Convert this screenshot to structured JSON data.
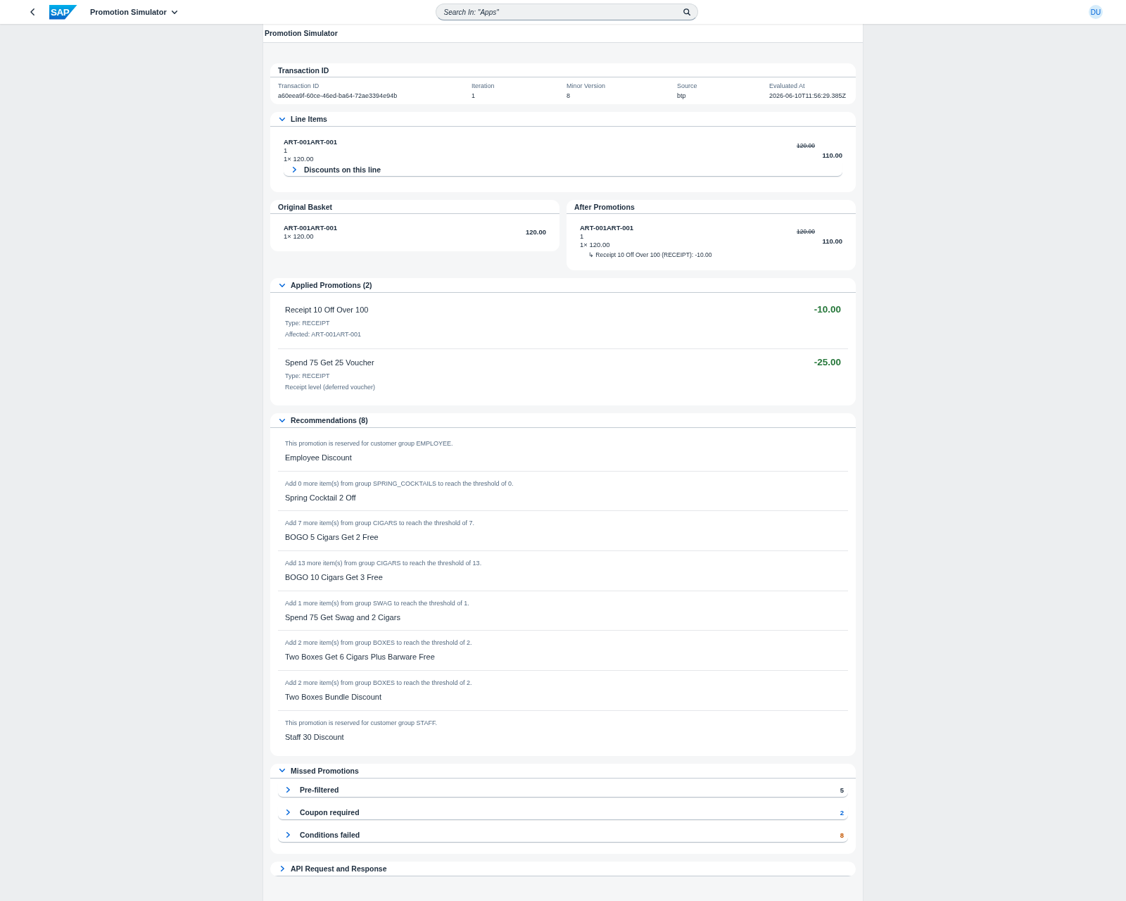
{
  "shell": {
    "logo": "SAP",
    "title": "Promotion Simulator",
    "search": {
      "placeholder": "Search In: \"Apps\""
    },
    "avatar": "DU"
  },
  "page_header": {
    "title": "Promotion Simulator"
  },
  "transaction": {
    "title": "Transaction ID",
    "fields": [
      {
        "label": "Transaction ID",
        "value": "a60eea9f-60ce-46ed-ba64-72ae3394e94b"
      },
      {
        "label": "Iteration",
        "value": "1"
      },
      {
        "label": "Minor Version",
        "value": "8"
      },
      {
        "label": "Source",
        "value": "btp"
      },
      {
        "label": "Evaluated At",
        "value": "2026-06-10T11:56:29.385Z"
      }
    ]
  },
  "line_items": {
    "title": "Line Items",
    "expanded": true,
    "items": [
      {
        "name": "ART-001ART-001",
        "quantity": "1",
        "unit_price": "1× 120.00",
        "original_price": "120.00",
        "price": "110.00",
        "discounts": {
          "title": "Discounts on this line",
          "expanded": false
        }
      }
    ]
  },
  "original_basket": {
    "title": "Original Basket",
    "items": [
      {
        "name": "ART-001ART-001",
        "unit_price": "1× 120.00",
        "price": "120.00"
      }
    ]
  },
  "after_promotions": {
    "title": "After Promotions",
    "items": [
      {
        "name": "ART-001ART-001",
        "quantity": "1",
        "unit_price": "1× 120.00",
        "original_price": "120.00",
        "price": "110.00",
        "notes": [
          "↳ Receipt 10 Off Over 100 (RECEIPT): -10.00"
        ]
      }
    ]
  },
  "applied_promotions": {
    "title": "Applied Promotions (2)",
    "expanded": true,
    "items": [
      {
        "name": "Receipt 10 Off Over 100",
        "amount": "-10.00",
        "details": [
          "Type: RECEIPT",
          "Affected: ART-001ART-001"
        ]
      },
      {
        "name": "Spend 75 Get 25 Voucher",
        "amount": "-25.00",
        "details": [
          "Type: RECEIPT",
          "Receipt level (deferred voucher)"
        ]
      }
    ]
  },
  "recommendations": {
    "title": "Recommendations (8)",
    "expanded": true,
    "items": [
      {
        "hint": "This promotion is reserved for customer group EMPLOYEE.",
        "name": "Employee Discount"
      },
      {
        "hint": "Add 0 more item(s) from group SPRING_COCKTAILS to reach the threshold of 0.",
        "name": "Spring Cocktail 2 Off"
      },
      {
        "hint": "Add 7 more item(s) from group CIGARS to reach the threshold of 7.",
        "name": "BOGO 5 Cigars Get 2 Free"
      },
      {
        "hint": "Add 13 more item(s) from group CIGARS to reach the threshold of 13.",
        "name": "BOGO 10 Cigars Get 3 Free"
      },
      {
        "hint": "Add 1 more item(s) from group SWAG to reach the threshold of 1.",
        "name": "Spend 75 Get Swag and 2 Cigars"
      },
      {
        "hint": "Add 2 more item(s) from group BOXES to reach the threshold of 2.",
        "name": "Two Boxes Get 6 Cigars Plus Barware Free"
      },
      {
        "hint": "Add 2 more item(s) from group BOXES to reach the threshold of 2.",
        "name": "Two Boxes Bundle Discount"
      },
      {
        "hint": "This promotion is reserved for customer group STAFF.",
        "name": "Staff 30 Discount"
      }
    ]
  },
  "missed_promotions": {
    "title": "Missed Promotions",
    "expanded": true,
    "groups": [
      {
        "label": "Pre-filtered",
        "count": "5",
        "color": "#1d2d3e",
        "expanded": false
      },
      {
        "label": "Coupon required",
        "count": "2",
        "color": "#0064d9",
        "expanded": false
      },
      {
        "label": "Conditions failed",
        "count": "8",
        "color": "#c35500",
        "expanded": false
      }
    ]
  },
  "api": {
    "title": "API Request and Response",
    "expanded": false
  }
}
